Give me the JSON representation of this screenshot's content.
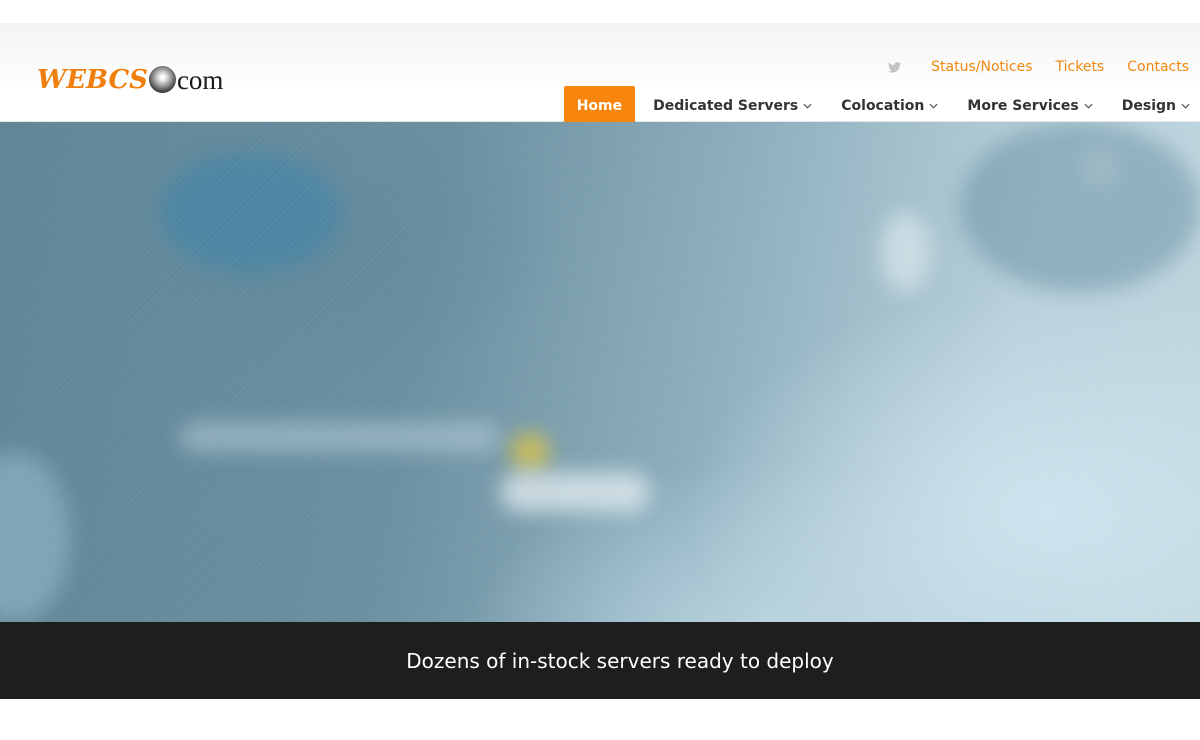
{
  "brand": {
    "logo_text_main": "WEBCS",
    "logo_text_suffix": "com",
    "logo_color": "#f07f0c"
  },
  "utility_nav": {
    "social_icon": "twitter-icon",
    "links": [
      "Status/Notices",
      "Tickets",
      "Contacts"
    ],
    "link_color": "#f0870f",
    "icon_color": "#c4c4c4"
  },
  "main_nav": {
    "items": [
      {
        "label": "Home",
        "active": true
      },
      {
        "label": "Dedicated Servers",
        "dropdown": true
      },
      {
        "label": "Colocation",
        "dropdown": true
      },
      {
        "label": "More Services",
        "dropdown": true
      },
      {
        "label": "Design",
        "dropdown": true
      }
    ],
    "active_bg": "#f7850e"
  },
  "hero": {
    "caption": "Dozens of in-stock servers ready to deploy"
  }
}
